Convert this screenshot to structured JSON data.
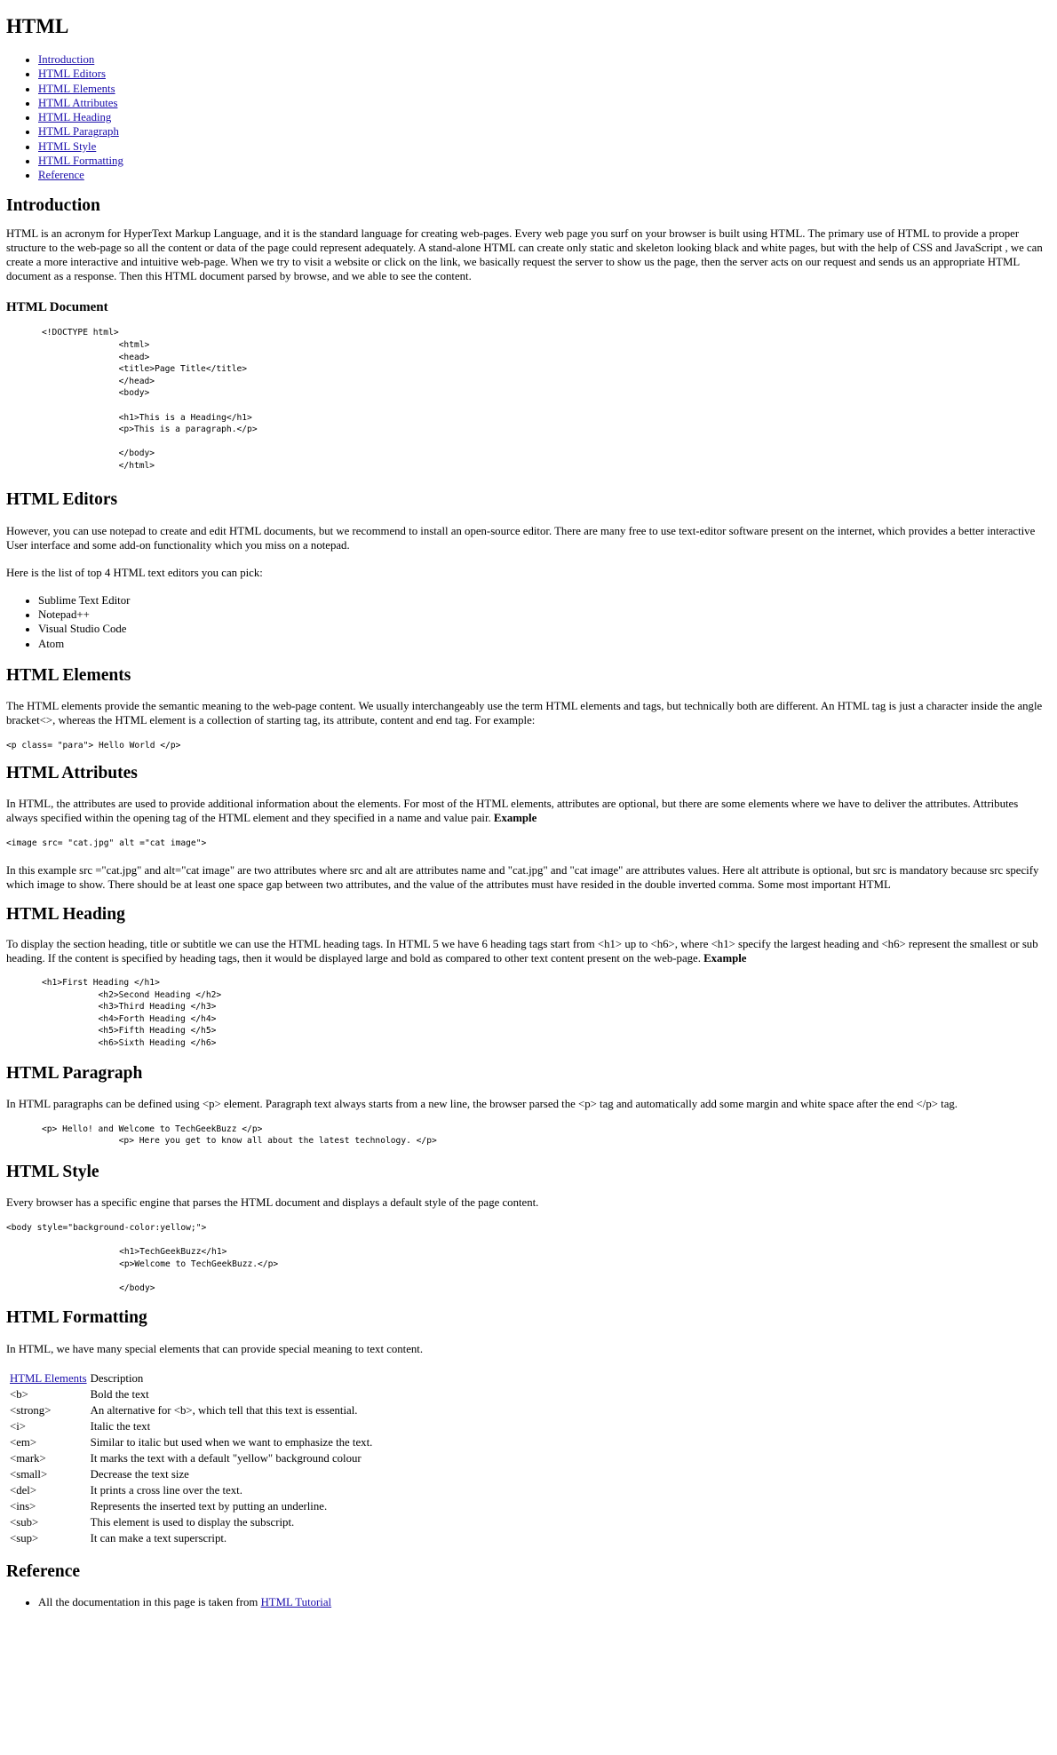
{
  "page_title": "HTML",
  "toc": [
    "Introduction",
    "HTML Editors",
    "HTML Elements",
    "HTML Attributes",
    "HTML Heading",
    "HTML Paragraph",
    "HTML Style",
    "HTML Formatting",
    "Reference"
  ],
  "introduction": {
    "heading": "Introduction",
    "paragraph": "HTML is an acronym for HyperText Markup Language, and it is the standard language for creating web-pages. Every web page you surf on your browser is built using HTML. The primary use of HTML to provide a proper structure to the web-page so all the content or data of the page could represent adequately. A stand-alone HTML can create only static and skeleton looking black and white pages, but with the help of CSS and JavaScript , we can create a more interactive and intuitive web-page. When we try to visit a website or click on the link, we basically request the server to show us the page, then the server acts on our request and sends us an appropriate HTML document as a response. Then this HTML document parsed by browse, and we able to see the content.",
    "doc_heading": "HTML Document",
    "doc_code": "<!DOCTYPE html>\n               <html>\n               <head>\n               <title>Page Title</title>\n               </head>\n               <body>\n\n               <h1>This is a Heading</h1>\n               <p>This is a paragraph.</p>\n\n               </body>\n               </html>"
  },
  "editors": {
    "heading": "HTML Editors",
    "paragraph1": "However, you can use notepad to create and edit HTML documents, but we recommend to install an open-source editor. There are many free to use text-editor software present on the internet, which provides a better interactive User interface and some add-on functionality which you miss on a notepad.",
    "paragraph2": "Here is the list of top 4 HTML text editors you can pick:",
    "list": [
      "Sublime Text Editor",
      "Notepad++",
      "Visual Studio Code",
      "Atom"
    ]
  },
  "elements": {
    "heading": "HTML Elements",
    "paragraph": "The HTML elements provide the semantic meaning to the web-page content. We usually interchangeably use the term HTML elements and tags, but technically both are different. An HTML tag is just a character inside the angle bracket<>, whereas the HTML element is a collection of starting tag, its attribute, content and end tag. For example:",
    "code": "<p class= \"para\"> Hello World </p>"
  },
  "attributes": {
    "heading": "HTML Attributes",
    "paragraph1": "In HTML, the attributes are used to provide additional information about the elements. For most of the HTML elements, attributes are optional, but there are some elements where we have to deliver the attributes. Attributes always specified within the opening tag of the HTML element and they specified in a name and value pair. ",
    "paragraph1_bold": "Example",
    "code": "<image src= \"cat.jpg\" alt =\"cat image\">",
    "paragraph2": "In this example src =\"cat.jpg\" and alt=\"cat image\" are two attributes where src and alt are attributes name and \"cat.jpg\" and \"cat image\" are attributes values. Here alt attribute is optional, but src is mandatory because src specify which image to show. There should be at least one space gap between two attributes, and the value of the attributes must have resided in the double inverted comma. Some most important HTML"
  },
  "heading_section": {
    "heading": "HTML Heading",
    "paragraph": "To display the section heading, title or subtitle we can use the HTML heading tags. In HTML 5 we have 6 heading tags start from <h1> up to <h6>, where <h1> specify the largest heading and <h6> represent the smallest or sub heading. If the content is specified by heading tags, then it would be displayed large and bold as compared to other text content present on the web-page. ",
    "paragraph_bold": "Example",
    "code": "<h1>First Heading </h1>\n           <h2>Second Heading </h2>\n           <h3>Third Heading </h3>\n           <h4>Forth Heading </h4>\n           <h5>Fifth Heading </h5>\n           <h6>Sixth Heading </h6>"
  },
  "paragraph_section": {
    "heading": "HTML Paragraph",
    "paragraph": "In HTML paragraphs can be defined using <p> element. Paragraph text always starts from a new line, the browser parsed the <p> tag and automatically add some margin and white space after the end </p> tag.",
    "code": "<p> Hello! and Welcome to TechGeekBuzz </p>\n               <p> Here you get to know all about the latest technology. </p>"
  },
  "style_section": {
    "heading": "HTML Style",
    "paragraph": "Every browser has a specific engine that parses the HTML document and displays a default style of the page content.",
    "code": "<body style=\"background-color:yellow;\">\n\n                      <h1>TechGeekBuzz</h1>\n                      <p>Welcome to TechGeekBuzz.</p>\n\n                      </body>"
  },
  "formatting": {
    "heading": "HTML Formatting",
    "paragraph": "In HTML, we have many special elements that can provide special meaning to text content.",
    "table_header": [
      "HTML Elements",
      "Description"
    ],
    "rows": [
      [
        "<b>",
        "Bold the text"
      ],
      [
        "<strong>",
        "An alternative for <b>, which tell that this text is essential."
      ],
      [
        "<i>",
        "Italic the text"
      ],
      [
        "<em>",
        "Similar to italic but used when we want to emphasize the text."
      ],
      [
        "<mark>",
        "It marks the text with a default \"yellow\" background colour"
      ],
      [
        "<small>",
        "Decrease the text size"
      ],
      [
        "<del>",
        "It prints a cross line over the text."
      ],
      [
        "<ins>",
        "Represents the inserted text by putting an underline."
      ],
      [
        "<sub>",
        "This element is used to display the subscript."
      ],
      [
        "<sup>",
        "It can make a text superscript."
      ]
    ]
  },
  "reference": {
    "heading": "Reference",
    "text": "All the documentation in this page is taken from ",
    "link": "HTML Tutorial"
  },
  "colors": {
    "link": "#1a0dab",
    "text": "#000000",
    "background": "#ffffff"
  }
}
